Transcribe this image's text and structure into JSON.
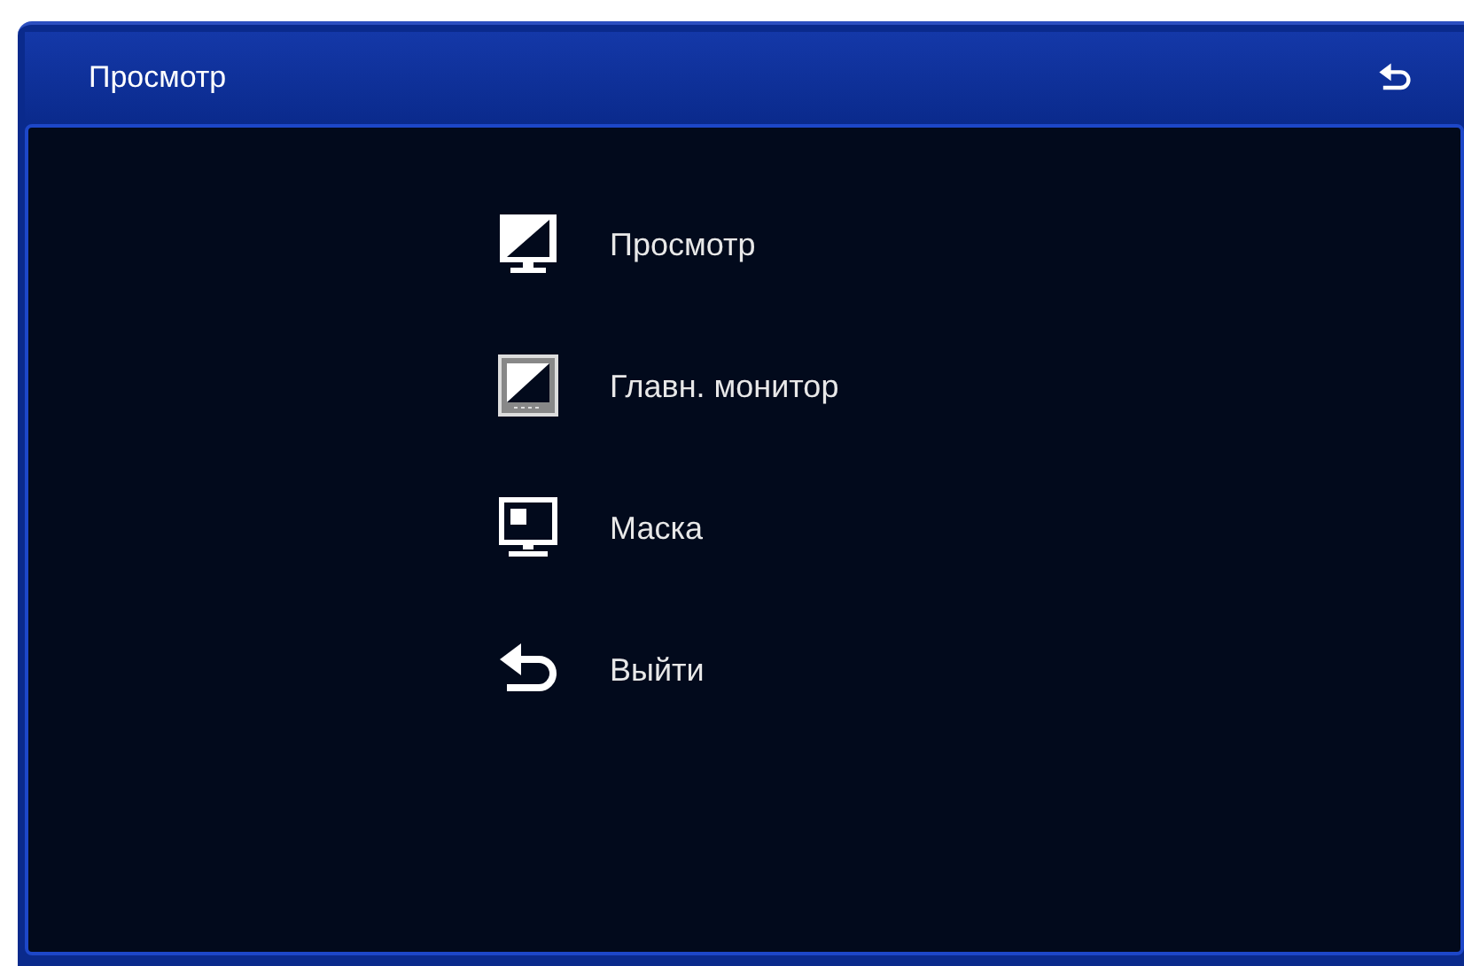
{
  "window": {
    "title": "Просмотр"
  },
  "menu": [
    {
      "kind": "display",
      "label": "Просмотр"
    },
    {
      "kind": "monitor",
      "label": "Главн. монитор"
    },
    {
      "kind": "mask",
      "label": "Маска"
    },
    {
      "kind": "exit",
      "label": "Выйти"
    }
  ]
}
